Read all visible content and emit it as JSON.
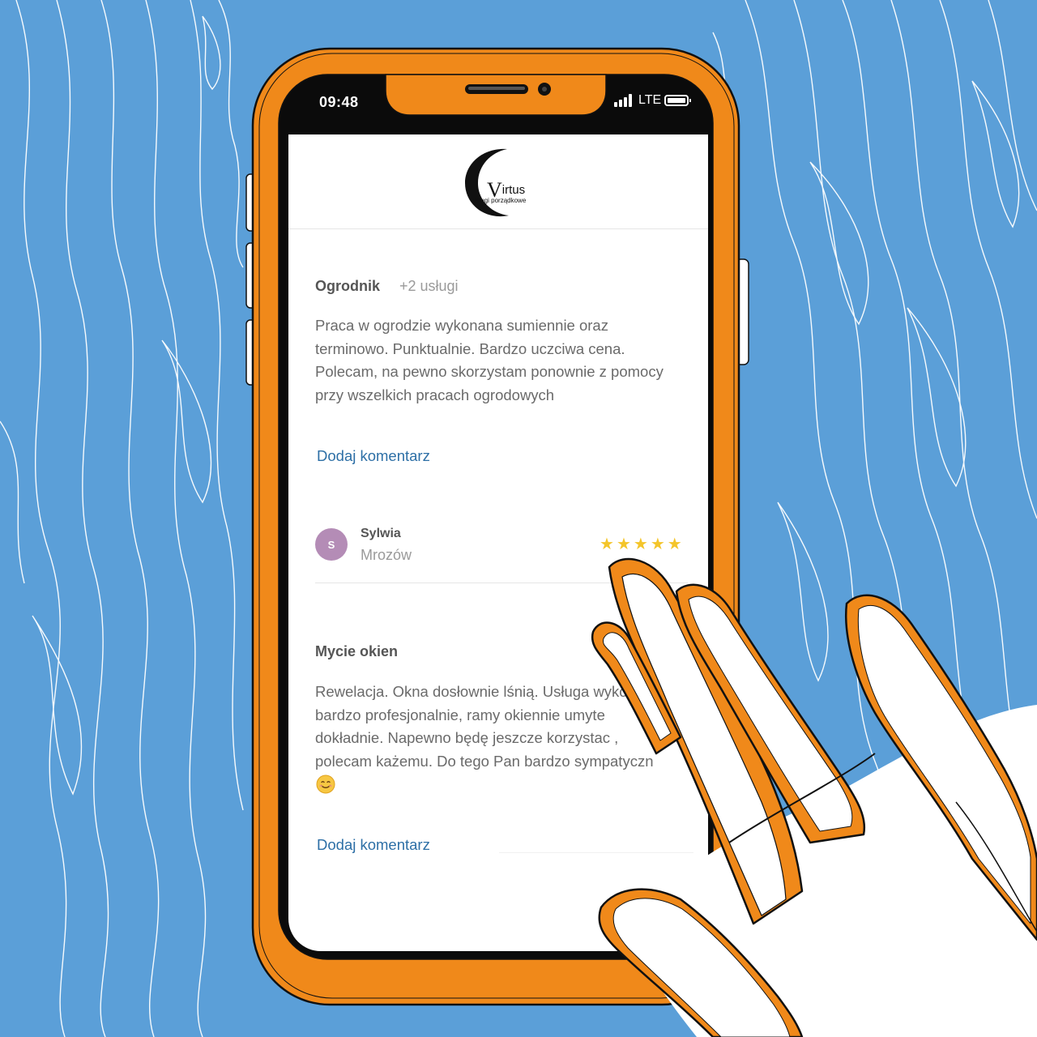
{
  "status_bar": {
    "time": "09:48",
    "network": "LTE"
  },
  "logo": {
    "name_initial": "V",
    "name_rest": "irtus",
    "tagline": "usługi porządkowe"
  },
  "reviews": [
    {
      "service": "Ogrodnik",
      "extra_services": "+2 usługi",
      "text": "Praca w ogrodzie wykonana sumiennie oraz\nterminowo. Punktualnie. Bardzo uczciwa cena.\nPolecam, na pewno skorzystam ponownie z pomocy\nprzy wszelkich pracach ogrodowych",
      "add_comment_label": "Dodaj komentarz"
    },
    {
      "reviewer_initial": "S",
      "reviewer_name": "Sylwia",
      "reviewer_city": "Mrozów",
      "rating": 5,
      "service": "Mycie okien",
      "text": "Rewelacja. Okna dosłownie lśnią. Usługa wyko\nbardzo profesjonalnie, ramy okiennie umyte\ndokładnie. Napewno będę jeszcze korzystac ,\npolecam każemu. Do tego Pan bardzo sympatyczn",
      "emoji": "smiling-face-icon",
      "add_comment_label": "Dodaj komentarz"
    }
  ],
  "colors": {
    "background": "#5b9fd8",
    "phone_case": "#f0891a",
    "link": "#2d6fa6",
    "star": "#f4c52a",
    "avatar": "#b48cb6"
  }
}
